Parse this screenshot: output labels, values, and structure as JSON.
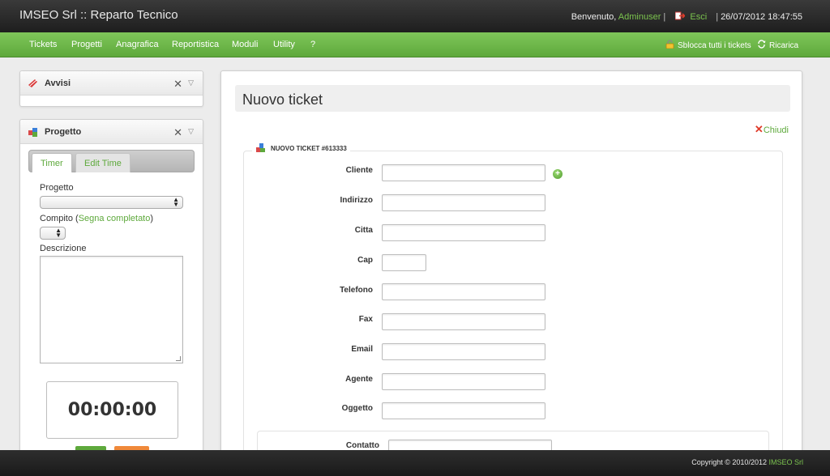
{
  "header": {
    "app_title": "IMSEO Srl :: Reparto Tecnico",
    "welcome_text": "Benvenuto,",
    "username": "Adminuser",
    "logout_label": "Esci",
    "datetime": "26/07/2012 18:47:55"
  },
  "menu": {
    "items": [
      "Tickets",
      "Progetti",
      "Anagrafica",
      "Reportistica",
      "Moduli",
      "Utility",
      "?"
    ],
    "unlock_label": "Sblocca tutti i tickets",
    "reload_label": "Ricarica"
  },
  "sidebar": {
    "avvisi": {
      "title": "Avvisi"
    },
    "progetto": {
      "title": "Progetto",
      "tabs": [
        "Timer",
        "Edit Time"
      ],
      "active_tab": "Timer",
      "project_label": "Progetto",
      "task_label": "Compito (",
      "task_link": "Segna completato",
      "task_label_end": ")",
      "description_label": "Descrizione",
      "timer_value": "00:00:00"
    }
  },
  "main": {
    "page_title": "Nuovo ticket",
    "close_label": "Chiudi",
    "form_legend": "NUOVO TICKET #613333",
    "fields": [
      {
        "label": "Cliente",
        "value": ""
      },
      {
        "label": "Indirizzo",
        "value": ""
      },
      {
        "label": "Citta",
        "value": ""
      },
      {
        "label": "Cap",
        "value": ""
      },
      {
        "label": "Telefono",
        "value": ""
      },
      {
        "label": "Fax",
        "value": ""
      },
      {
        "label": "Email",
        "value": ""
      },
      {
        "label": "Agente",
        "value": ""
      },
      {
        "label": "Oggetto",
        "value": ""
      }
    ],
    "contact_label": "Contatto"
  },
  "footer": {
    "copyright": "Copyright © 2010/2012",
    "company": "IMSEO Srl"
  },
  "colors": {
    "accent_green": "#5ea93c",
    "close_red": "#e03b2a",
    "timer_button_orange": "#f0893a"
  }
}
